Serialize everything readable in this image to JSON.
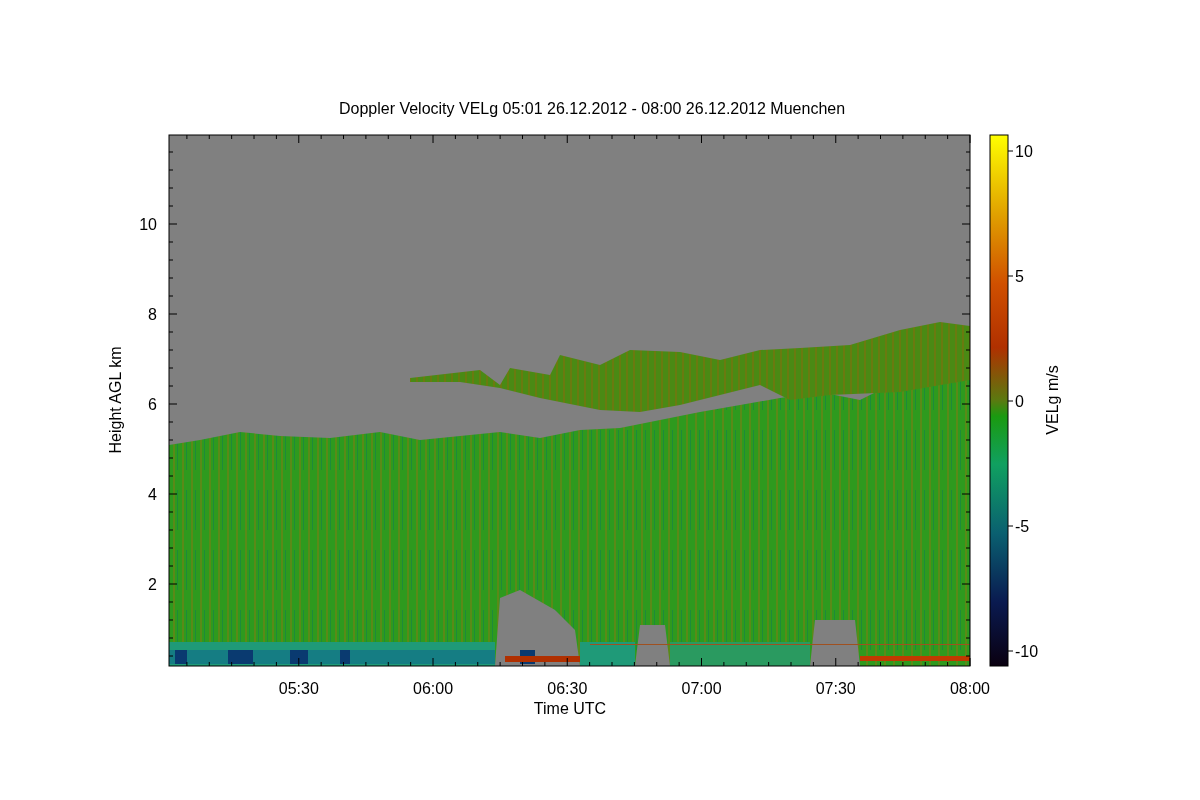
{
  "title": "Doppler Velocity VELg   05:01 26.12.2012 - 08:00 26.12.2012 Muenchen",
  "y_axis": {
    "label": "Height AGL km",
    "ticks": [
      "10",
      "8",
      "6",
      "4",
      "2"
    ]
  },
  "x_axis": {
    "label": "Time UTC",
    "ticks": [
      "05:30",
      "06:00",
      "06:30",
      "07:00",
      "07:30",
      "08:00"
    ]
  },
  "colorbar": {
    "label": "VELg m/s",
    "ticks": [
      "10",
      "5",
      "0",
      "-5",
      "-10"
    ]
  }
}
